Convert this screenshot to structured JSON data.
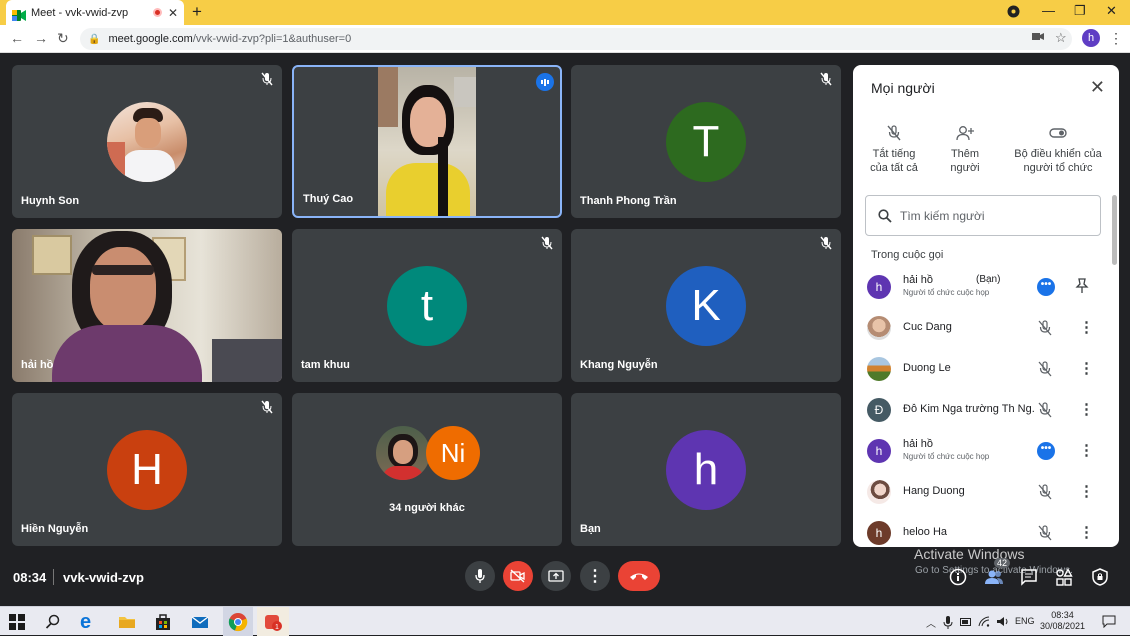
{
  "browser": {
    "tab_title": "Meet - vvk-vwid-zvp",
    "url_domain": "meet.google.com",
    "url_path": "/vvk-vwid-zvp?pli=1&authuser=0",
    "profile_initial": "h"
  },
  "tiles": [
    {
      "name": "Huynh Son",
      "muted": true,
      "kind": "photo"
    },
    {
      "name": "Thuý Cao",
      "muted": false,
      "kind": "video",
      "speaking": true
    },
    {
      "name": "Thanh Phong Trần",
      "muted": true,
      "kind": "letter",
      "letter": "T",
      "color": "#2d6a1f"
    },
    {
      "name": "hải hồ",
      "muted": false,
      "kind": "video"
    },
    {
      "name": "tam khuu",
      "muted": true,
      "kind": "letter",
      "letter": "t",
      "color": "#00897b"
    },
    {
      "name": "Khang Nguyễn",
      "muted": true,
      "kind": "letter",
      "letter": "K",
      "color": "#1f5fbf"
    },
    {
      "name": "Hiền Nguyễn",
      "muted": true,
      "kind": "letter",
      "letter": "H",
      "color": "#c9400f"
    },
    {
      "name": "34 người khác",
      "muted": false,
      "kind": "group",
      "letter": "Ni",
      "color": "#ef6c00"
    },
    {
      "name": "Bạn",
      "muted": false,
      "kind": "letter",
      "letter": "h",
      "color": "#5e35b1"
    }
  ],
  "bottom_bar": {
    "time": "08:34",
    "meeting_code": "vvk-vwid-zvp",
    "people_count": "42",
    "activate_title": "Activate Windows",
    "activate_sub": "Go to Settings to activate Windows."
  },
  "panel": {
    "title": "Mọi người",
    "actions": [
      {
        "label1": "Tắt tiếng",
        "label2": "của tất cả"
      },
      {
        "label1": "Thêm",
        "label2": "người"
      },
      {
        "label1": "Bộ điều khiển của",
        "label2": "người tổ chức"
      }
    ],
    "search_placeholder": "Tìm kiếm người",
    "section_label": "Trong cuộc gọi",
    "participants": [
      {
        "name": "hải hồ",
        "you": "(Bạn)",
        "sub": "Người tổ chức cuộc họp",
        "initial": "h",
        "color": "#5e35b1",
        "speaking": true
      },
      {
        "name": "Cuc Dang",
        "initial": "",
        "color": "#c9a78f"
      },
      {
        "name": "Duong Le",
        "initial": "",
        "color": "#6f8f3a"
      },
      {
        "name": "Đỗ Kim Nga trường Th Ng...",
        "initial": "Đ",
        "color": "#455a64"
      },
      {
        "name": "hải hồ",
        "sub": "Người tổ chức cuộc họp",
        "initial": "h",
        "color": "#5e35b1",
        "speaking": true
      },
      {
        "name": "Hang Duong",
        "initial": "",
        "color": "#e8cfc6"
      },
      {
        "name": "heloo Ha",
        "initial": "h",
        "color": "#6d3b2a"
      }
    ]
  },
  "taskbar": {
    "lang": "ENG",
    "time": "08:34",
    "date": "30/08/2021"
  }
}
